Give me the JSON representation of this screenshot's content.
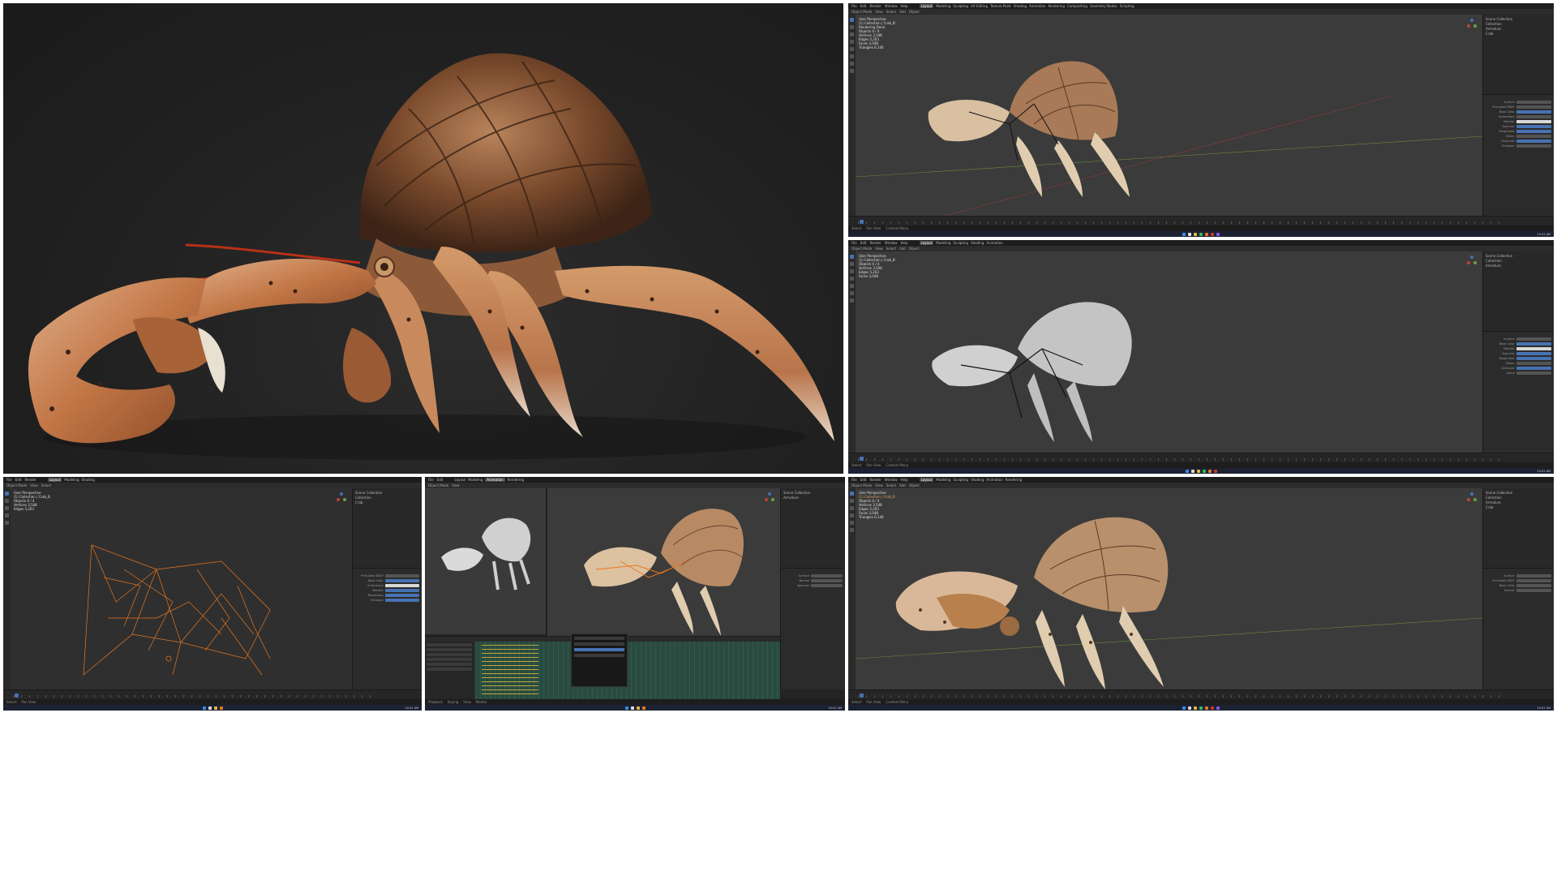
{
  "colors": {
    "blender_bg": "#232323",
    "viewport_bg": "#3b3b3b",
    "accent_blue": "#4772b3",
    "crab_shell": "#c8824a",
    "crab_dark": "#6b3e22",
    "wire_orange": "#e8761e",
    "clay_grey": "#bdbdbd"
  },
  "blender": {
    "menu": [
      "File",
      "Edit",
      "Render",
      "Window",
      "Help"
    ],
    "workspaces": [
      "Layout",
      "Modeling",
      "Sculpting",
      "UV Editing",
      "Texture Paint",
      "Shading",
      "Animation",
      "Rendering",
      "Compositing",
      "Geometry Nodes",
      "Scripting"
    ],
    "active_workspace": "Layout",
    "viewport_header": [
      "Object Mode",
      "View",
      "Select",
      "Add",
      "Object"
    ],
    "viewport_title": "User Perspective",
    "collection_path": "(1) Collection | Crab_B",
    "rendering_text": "Rendering Done",
    "stats_labels": [
      "Objects",
      "Vertices",
      "Edges",
      "Faces",
      "Triangles"
    ],
    "stats_values": [
      "0 / 4",
      "3,548",
      "5,203",
      "3,048",
      "6,140"
    ],
    "outliner": [
      "Scene Collection",
      "Collection",
      "Armature",
      "Crab"
    ],
    "material_props": [
      "Surface",
      "Principled BSDF",
      "Base Color",
      "Subsurface",
      "Metallic",
      "Specular",
      "Roughness",
      "Sheen",
      "Clearcoat",
      "Emission",
      "Alpha",
      "Normal"
    ],
    "status_items": [
      "Select",
      "Pan View",
      "Context Menu"
    ],
    "timeline_items": [
      "Playback",
      "Keying",
      "View",
      "Marker"
    ],
    "clock": "10:41 AM"
  }
}
